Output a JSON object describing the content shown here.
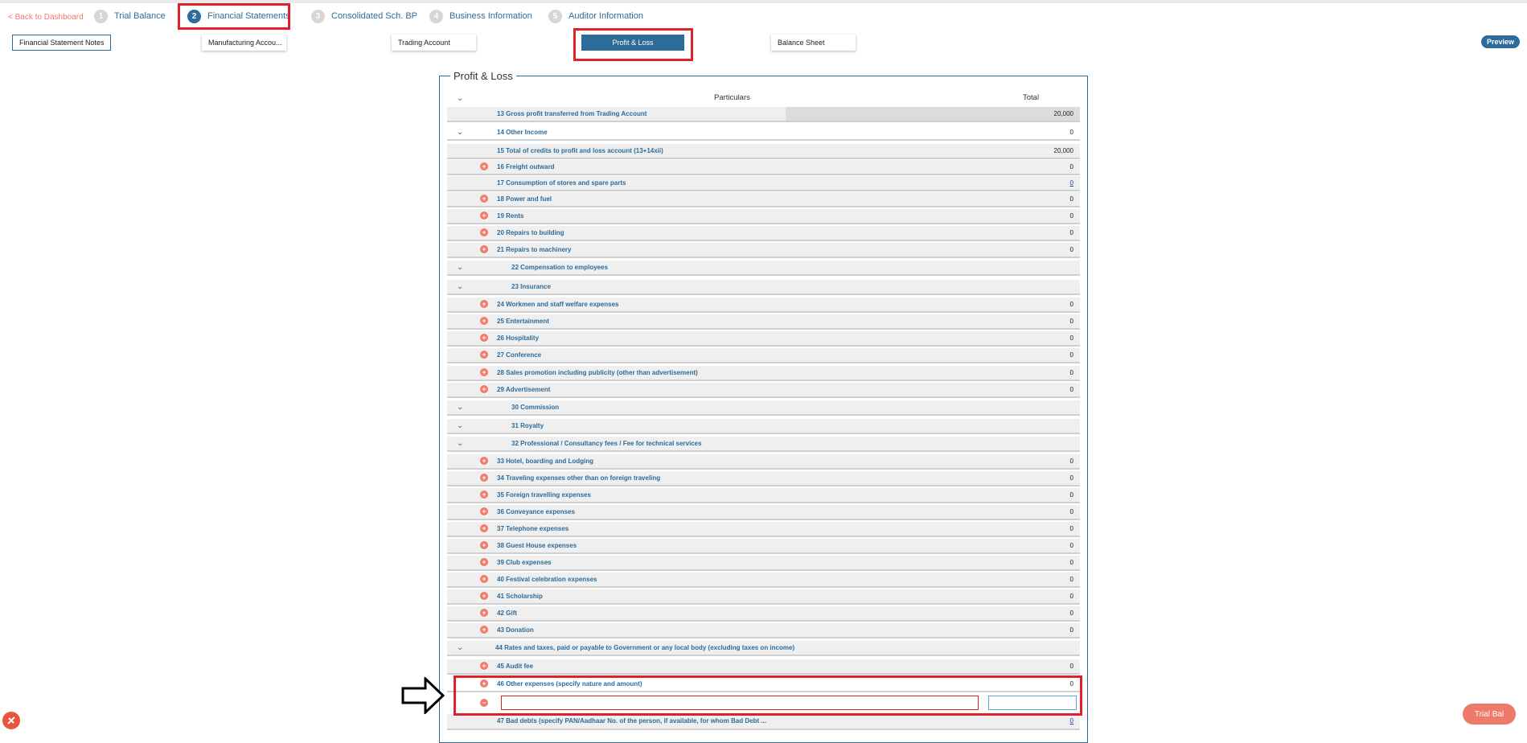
{
  "nav": {
    "back_label": "< Back to Dashboard",
    "steps": [
      {
        "num": "1",
        "label": "Trial Balance"
      },
      {
        "num": "2",
        "label": "Financial Statements"
      },
      {
        "num": "3",
        "label": "Consolidated Sch. BP"
      },
      {
        "num": "4",
        "label": "Business Information"
      },
      {
        "num": "5",
        "label": "Auditor Information"
      }
    ]
  },
  "tabs": {
    "notes": "Financial Statement Notes",
    "manufacturing": "Manufacturing Accou...",
    "trading": "Trading Account",
    "pl": "Profit & Loss",
    "balance": "Balance Sheet"
  },
  "preview_label": "Preview",
  "panel": {
    "title": "Profit & Loss",
    "col_particulars": "Particulars",
    "col_total": "Total"
  },
  "rows": [
    {
      "label": "13  Gross profit transferred from Trading Account",
      "value": "20,000"
    },
    {
      "label": "14  Other Income",
      "value": "0"
    },
    {
      "label": "15  Total of credits to profit and loss account (13+14xii)",
      "value": "20,000"
    },
    {
      "label": "16  Freight outward",
      "value": "0"
    },
    {
      "label": "17  Consumption of stores and spare parts",
      "value": "0"
    },
    {
      "label": "18  Power and fuel",
      "value": "0"
    },
    {
      "label": "19  Rents",
      "value": "0"
    },
    {
      "label": "20  Repairs to building",
      "value": "0"
    },
    {
      "label": "21  Repairs to machinery",
      "value": "0"
    },
    {
      "label": "22  Compensation to employees",
      "value": ""
    },
    {
      "label": "23  Insurance",
      "value": ""
    },
    {
      "label": "24  Workmen and staff welfare expenses",
      "value": "0"
    },
    {
      "label": "25  Entertainment",
      "value": "0"
    },
    {
      "label": "26  Hospitality",
      "value": "0"
    },
    {
      "label": "27  Conference",
      "value": "0"
    },
    {
      "label": "28  Sales promotion including publicity (other than advertisement)",
      "value": "0"
    },
    {
      "label": "29  Advertisement",
      "value": "0"
    },
    {
      "label": "30  Commission",
      "value": ""
    },
    {
      "label": "31  Royalty",
      "value": ""
    },
    {
      "label": "32  Professional / Consultancy fees / Fee for technical services",
      "value": ""
    },
    {
      "label": "33  Hotel, boarding and Lodging",
      "value": "0"
    },
    {
      "label": "34  Traveling expenses other than on foreign traveling",
      "value": "0"
    },
    {
      "label": "35  Foreign travelling expenses",
      "value": "0"
    },
    {
      "label": "36  Conveyance expenses",
      "value": "0"
    },
    {
      "label": "37  Telephone expenses",
      "value": "0"
    },
    {
      "label": "38  Guest House expenses",
      "value": "0"
    },
    {
      "label": "39  Club expenses",
      "value": "0"
    },
    {
      "label": "40  Festival celebration expenses",
      "value": "0"
    },
    {
      "label": "41  Scholarship",
      "value": "0"
    },
    {
      "label": "42  Gift",
      "value": "0"
    },
    {
      "label": "43  Donation",
      "value": "0"
    },
    {
      "label": "44  Rates and taxes, paid or payable to Government or any local body (excluding taxes on income)",
      "value": ""
    },
    {
      "label": "45  Audit fee",
      "value": "0"
    },
    {
      "label": "46  Other expenses (specify nature and amount)",
      "value": "0"
    },
    {
      "label": "47  Bad debts (specify PAN/Aadhaar No. of the person, if available, for whom Bad Debt ...",
      "value": "0"
    }
  ],
  "other_expense_input": {
    "particular": "",
    "amount": ""
  },
  "trial_bal_label": "Trial Bal",
  "colors": {
    "primary": "#2c6b9a",
    "accent": "#f07a6a",
    "highlight": "#e0202a"
  }
}
